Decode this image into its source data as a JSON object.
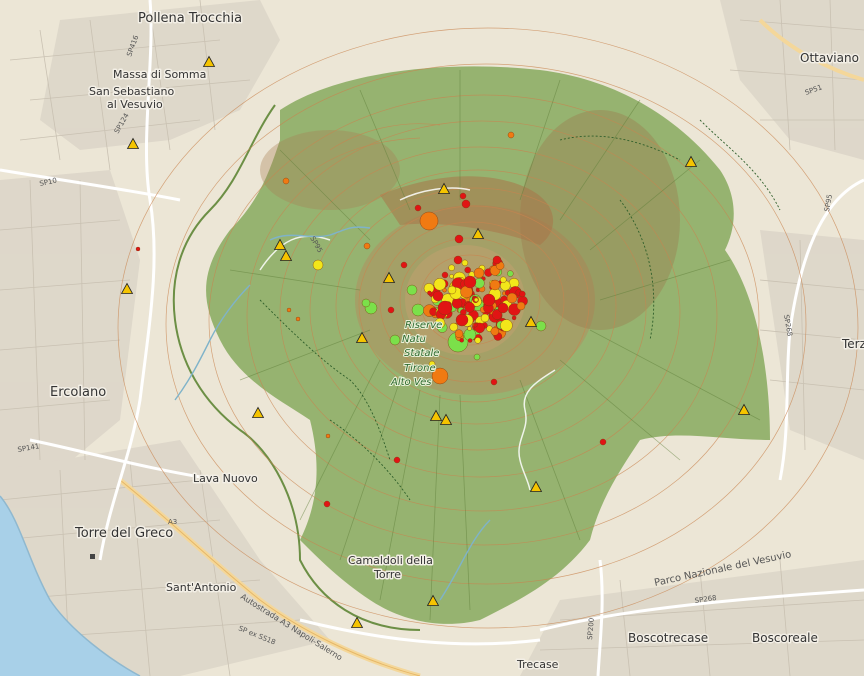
{
  "map": {
    "colors": {
      "land": "#ece6d6",
      "park": "#6f9a48",
      "sea": "#a8d0e8",
      "urban": "#d9d2c6",
      "road_major": "#ffffff",
      "road_highway": "#f4d79a",
      "contour": "#c9844f",
      "summit_brown": "#a9774e",
      "waterway": "#7fb3c9"
    },
    "towns": [
      {
        "name": "Pollena Trocchia"
      },
      {
        "name": "Massa di Somma"
      },
      {
        "name": "San Sebastiano"
      },
      {
        "name": "al Vesuvio"
      },
      {
        "name": "Ottaviano"
      },
      {
        "name": "Ercolano"
      },
      {
        "name": "Lava Nuovo"
      },
      {
        "name": "Torre del Greco"
      },
      {
        "name": "Sant'Antonio"
      },
      {
        "name": "Camaldoli della"
      },
      {
        "name": "Torre"
      },
      {
        "name": "Boscotrecase"
      },
      {
        "name": "Boscoreale"
      },
      {
        "name": "Trecase"
      },
      {
        "name": "Terz"
      }
    ],
    "park_label": "Parco Nazionale del Vesuvio",
    "reserve_label": [
      "Riserve",
      "Natu",
      "Statale",
      "Tirone",
      "Alto Ves"
    ],
    "road_labels": [
      "SP416",
      "SP10",
      "SP124",
      "SP51",
      "SP95",
      "SP268",
      "SP95",
      "SP141",
      "A3",
      "Autostrada A3 Napoli-Salerno",
      "SP ex SS18",
      "SP200",
      "SP268"
    ],
    "stations_icon": "warning-triangle-icon",
    "quake_colors": {
      "red": "#e11414",
      "orange": "#f07a12",
      "yellow": "#f2e61a",
      "green": "#7be04a"
    }
  }
}
